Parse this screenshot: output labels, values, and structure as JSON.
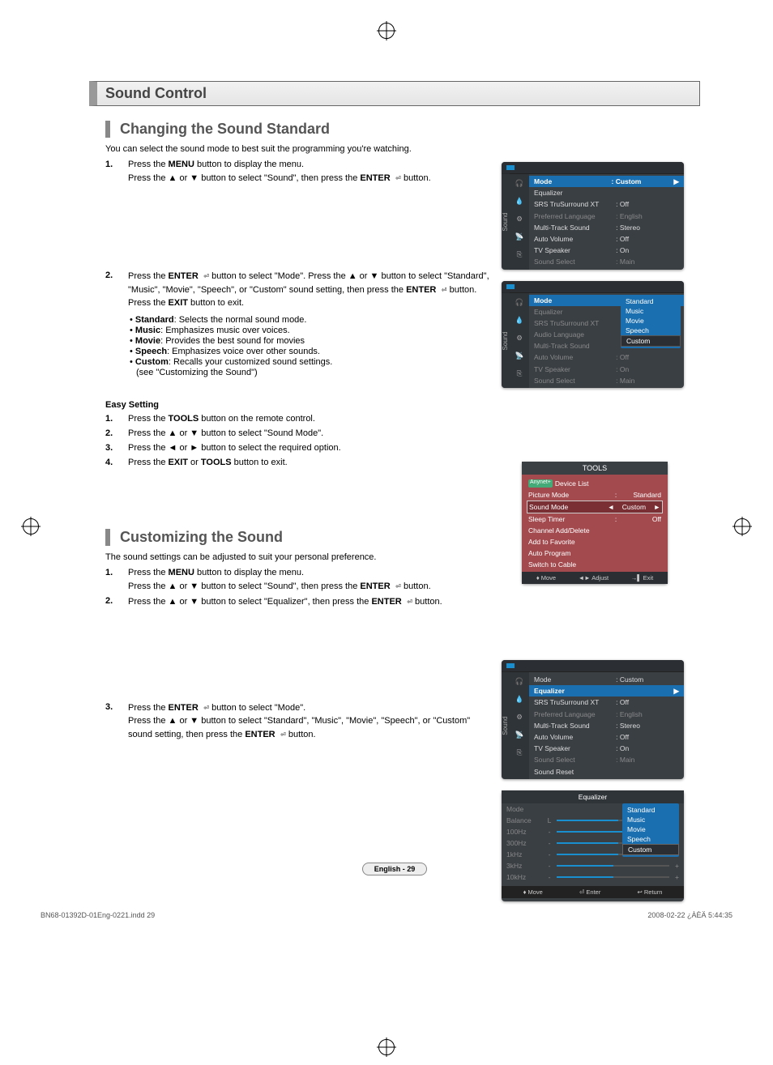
{
  "section_title": "Sound Control",
  "h1": "Changing the Sound Standard",
  "intro1": "You can select the sound mode to best suit the programming you're watching.",
  "s1a": {
    "num": "1.",
    "l1a": "Press the ",
    "l1b": "MENU",
    "l1c": " button to display the menu.",
    "l2a": "Press the ▲ or ▼ button to select \"Sound\", then press the ",
    "l2b": "ENTER",
    "l2c": " button."
  },
  "s2a": {
    "num": "2.",
    "l1a": "Press the ",
    "l1b": "ENTER",
    "l1c": " button to select \"Mode\". Press the ▲ or ▼ button to select \"Standard\", \"Music\", \"Movie\", \"Speech\", or \"Custom\" sound setting, then press the ",
    "l1d": "ENTER",
    "l1e": " button.",
    "exitA": "Press the ",
    "exitB": "EXIT",
    "exitC": " button to exit."
  },
  "bullets": {
    "std_k": "Standard",
    "std_v": ": Selects the normal sound mode.",
    "mus_k": "Music",
    "mus_v": ": Emphasizes music over voices.",
    "mov_k": "Movie",
    "mov_v": ": Provides the best sound for movies",
    "spc_k": "Speech",
    "spc_v": ": Emphasizes voice over other sounds.",
    "cus_k": "Custom",
    "cus_v": ": Recalls your customized sound settings.",
    "cus_note": "(see \"Customizing the Sound\")"
  },
  "easy_title": "Easy Setting",
  "easy": {
    "s1n": "1.",
    "s1a": "Press the ",
    "s1b": "TOOLS",
    "s1c": " button on the remote control.",
    "s2n": "2.",
    "s2": "Press the ▲ or ▼ button to select \"Sound Mode\".",
    "s3n": "3.",
    "s3": "Press the ◄ or ► button to select the required option.",
    "s4n": "4.",
    "s4a": "Press the ",
    "s4b": "EXIT",
    "s4c": " or ",
    "s4d": "TOOLS",
    "s4e": " button to exit."
  },
  "h2": "Customizing the Sound",
  "intro2": "The sound settings can be adjusted to suit your personal preference.",
  "c1": {
    "num": "1.",
    "l1a": "Press the ",
    "l1b": "MENU",
    "l1c": " button to display the menu.",
    "l2a": "Press the ▲ or ▼ button to select \"Sound\", then press the ",
    "l2b": "ENTER",
    "l2c": " button."
  },
  "c2": {
    "num": "2.",
    "l1a": "Press the ▲ or ▼ button to select \"Equalizer\", then press the ",
    "l1b": "ENTER",
    "l1c": " button."
  },
  "c3": {
    "num": "3.",
    "l1a": "Press the ",
    "l1b": "ENTER",
    "l1c": " button to select \"Mode\".",
    "l2a": "Press the ▲ or ▼ button to select \"Standard\", \"Music\", \"Movie\", \"Speech\", or \"Custom\" sound setting, then press the ",
    "l2b": "ENTER",
    "l2c": " button."
  },
  "osd1": {
    "side": "Sound",
    "r1k": "Mode",
    "r1v": ": Custom",
    "r2k": "Equalizer",
    "r3k": "SRS TruSurround XT",
    "r3v": ": Off",
    "r4k": "Preferred Language",
    "r4v": ": English",
    "r5k": "Multi-Track Sound",
    "r5v": ": Stereo",
    "r6k": "Auto Volume",
    "r6v": ": Off",
    "r7k": "TV Speaker",
    "r7v": ": On",
    "r8k": "Sound Select",
    "r8v": ": Main"
  },
  "osd2": {
    "side": "Sound",
    "r1k": "Mode",
    "r2k": "Equalizer",
    "r3k": "SRS TruSurround XT",
    "r4k": "Audio Language",
    "r5k": "Multi-Track Sound",
    "r6k": "Auto Volume",
    "r6v": ": Off",
    "r7k": "TV Speaker",
    "r7v": ": On",
    "r8k": "Sound Select",
    "r8v": ": Main",
    "p1": "Standard",
    "p2": "Music",
    "p3": "Movie",
    "p4": "Speech",
    "p5": "Custom"
  },
  "tools": {
    "title": "TOOLS",
    "r0": "Device List",
    "r1k": "Picture Mode",
    "r1v": "Standard",
    "r2k": "Sound Mode",
    "r2v": "Custom",
    "r3k": "Sleep Timer",
    "r3v": "Off",
    "r4": "Channel Add/Delete",
    "r5": "Add to Favorite",
    "r6": "Auto Program",
    "r7": "Switch to Cable",
    "f1": "Move",
    "f2": "Adjust",
    "f3": "Exit"
  },
  "osd3": {
    "side": "Sound",
    "r1k": "Mode",
    "r1v": ": Custom",
    "r2k": "Equalizer",
    "r3k": "SRS TruSurround XT",
    "r3v": ": Off",
    "r4k": "Preferred Language",
    "r4v": ": English",
    "r5k": "Multi-Track Sound",
    "r5v": ": Stereo",
    "r6k": "Auto Volume",
    "r6v": ": Off",
    "r7k": "TV Speaker",
    "r7v": ": On",
    "r8k": "Sound Select",
    "r8v": ": Main",
    "r9k": "Sound Reset"
  },
  "eq": {
    "title": "Equalizer",
    "r1": "Mode",
    "r2": "Balance",
    "r2m": "L",
    "r3": "100Hz",
    "rm": "-",
    "r4": "300Hz",
    "r5": "1kHz",
    "r6": "3kHz",
    "r7": "10kHz",
    "p1": "Standard",
    "p2": "Music",
    "p3": "Movie",
    "p4": "Speech",
    "p5": "Custom",
    "f1": "Move",
    "f2": "Enter",
    "f3": "Return"
  },
  "page_num": "English - 29",
  "doc_footer_l": "BN68-01392D-01Eng-0221.indd   29",
  "doc_footer_r": "2008-02-22   ¿ÀÈÄ 5:44:35"
}
